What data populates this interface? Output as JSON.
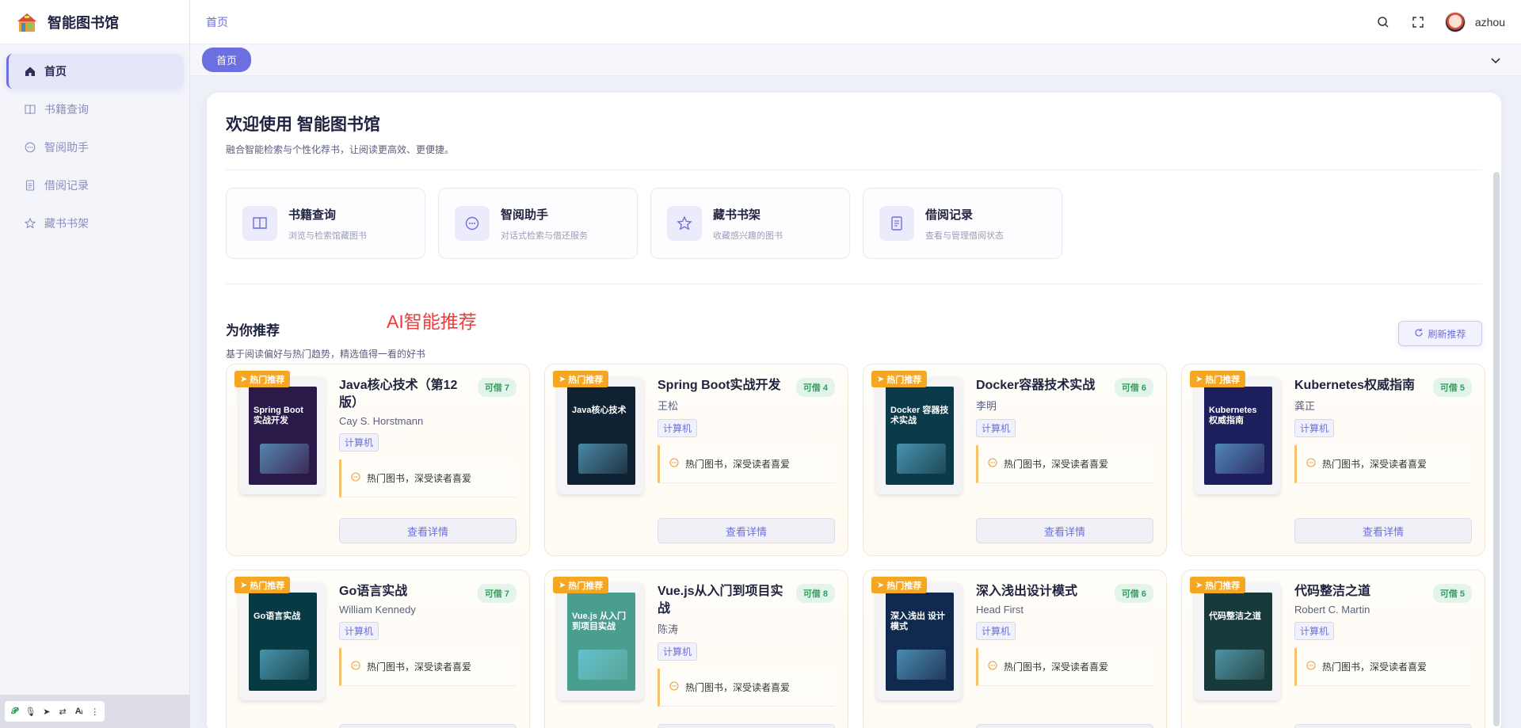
{
  "app": {
    "title": "智能图书馆"
  },
  "sidebar": {
    "items": [
      {
        "label": "首页",
        "icon": "home-icon"
      },
      {
        "label": "书籍查询",
        "icon": "book-icon"
      },
      {
        "label": "智阅助手",
        "icon": "chat-icon"
      },
      {
        "label": "借阅记录",
        "icon": "document-icon"
      },
      {
        "label": "藏书书架",
        "icon": "star-icon"
      }
    ]
  },
  "header": {
    "breadcrumb": "首页",
    "username": "azhou"
  },
  "tabs": {
    "active": "首页"
  },
  "welcome": {
    "title": "欢迎使用 智能图书馆",
    "subtitle": "融合智能检索与个性化荐书，让阅读更高效、更便捷。"
  },
  "quick_links": [
    {
      "title": "书籍查询",
      "desc": "浏览与检索馆藏图书",
      "icon": "book-icon"
    },
    {
      "title": "智阅助手",
      "desc": "对话式检索与借还服务",
      "icon": "chat-icon"
    },
    {
      "title": "藏书书架",
      "desc": "收藏感兴趣的图书",
      "icon": "star-icon"
    },
    {
      "title": "借阅记录",
      "desc": "查看与管理借阅状态",
      "icon": "document-icon"
    }
  ],
  "recommend": {
    "title": "为你推荐",
    "annotation": "AI智能推荐",
    "subtitle": "基于阅读偏好与热门趋势，精选值得一看的好书",
    "refresh_label": "刷新推荐",
    "hot_label": "热门推荐",
    "detail_label": "查看详情",
    "books": [
      {
        "title": "Java核心技术（第12版）",
        "author": "Cay S. Horstmann",
        "category": "计算机",
        "available": "可借 7",
        "reason": "热门图书，深受读者喜爱",
        "cover_text": "Spring Boot 实战开发",
        "cover_color": "#2a1a4a"
      },
      {
        "title": "Spring Boot实战开发",
        "author": "王松",
        "category": "计算机",
        "available": "可借 4",
        "reason": "热门图书，深受读者喜爱",
        "cover_text": "Java核心技术",
        "cover_color": "#0f2233"
      },
      {
        "title": "Docker容器技术实战",
        "author": "李明",
        "category": "计算机",
        "available": "可借 6",
        "reason": "热门图书，深受读者喜爱",
        "cover_text": "Docker 容器技术实战",
        "cover_color": "#0b3a4a"
      },
      {
        "title": "Kubernetes权威指南",
        "author": "龚正",
        "category": "计算机",
        "available": "可借 5",
        "reason": "热门图书，深受读者喜爱",
        "cover_text": "Kubernetes 权威指南",
        "cover_color": "#1d1f5c"
      },
      {
        "title": "Go语言实战",
        "author": "William Kennedy",
        "category": "计算机",
        "available": "可借 7",
        "reason": "热门图书，深受读者喜爱",
        "cover_text": "Go语言实战",
        "cover_color": "#083a44"
      },
      {
        "title": "Vue.js从入门到项目实战",
        "author": "陈涛",
        "category": "计算机",
        "available": "可借 8",
        "reason": "热门图书，深受读者喜爱",
        "cover_text": "Vue.js 从入门到项目实战",
        "cover_color": "#4a9e90"
      },
      {
        "title": "深入浅出设计模式",
        "author": "Head First",
        "category": "计算机",
        "available": "可借 6",
        "reason": "热门图书，深受读者喜爱",
        "cover_text": "深入浅出 设计模式",
        "cover_color": "#10294f"
      },
      {
        "title": "代码整洁之道",
        "author": "Robert C. Martin",
        "category": "计算机",
        "available": "可借 5",
        "reason": "热门图书，深受读者喜爱",
        "cover_text": "代码整洁之道",
        "cover_color": "#183a3a"
      }
    ]
  },
  "colors": {
    "accent": "#6c6fe0",
    "hot": "#f5a623",
    "available": "#2e9e5b",
    "annotation": "#ef3b3b"
  }
}
